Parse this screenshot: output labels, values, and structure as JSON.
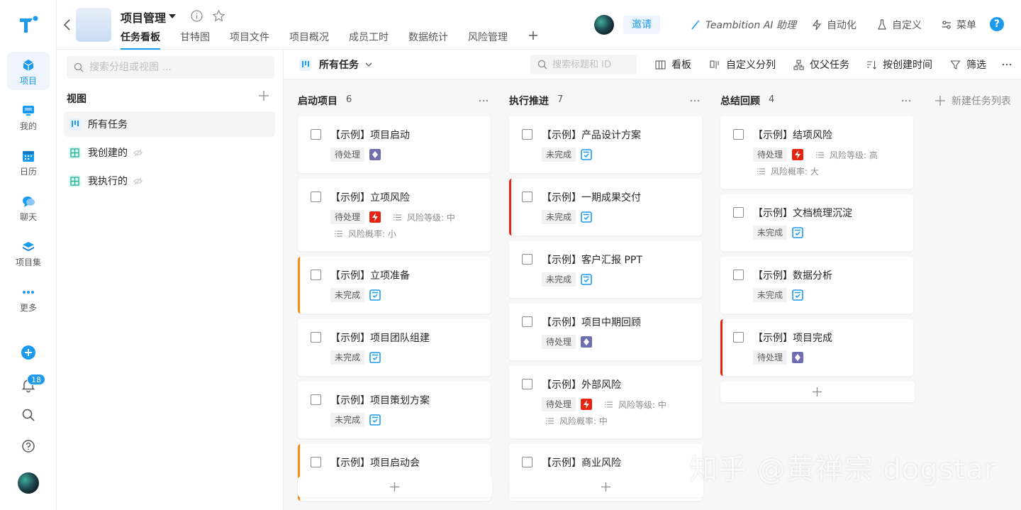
{
  "rail": {
    "items": [
      {
        "label": "项目",
        "icon": "cube-icon"
      },
      {
        "label": "我的",
        "icon": "monitor-icon"
      },
      {
        "label": "日历",
        "icon": "calendar-icon"
      },
      {
        "label": "聊天",
        "icon": "chat-icon"
      },
      {
        "label": "项目集",
        "icon": "layers-icon"
      },
      {
        "label": "更多",
        "icon": "more-icon"
      }
    ],
    "notification_count": "18"
  },
  "header": {
    "project_name": "项目管理",
    "tabs": [
      "任务看板",
      "甘特图",
      "项目文件",
      "项目概况",
      "成员工时",
      "数据统计",
      "风险管理"
    ],
    "invite_label": "邀请",
    "ai_label": "Teambition AI 助理",
    "automation_label": "自动化",
    "customize_label": "自定义",
    "menu_label": "菜单",
    "help_label": "?"
  },
  "views_panel": {
    "search_placeholder": "搜索分组或视图 ...",
    "title": "视图",
    "items": [
      "所有任务",
      "我创建的",
      "我执行的"
    ]
  },
  "toolbar": {
    "current_view": "所有任务",
    "search_placeholder": "搜索标题和 ID",
    "board_label": "看板",
    "custom_columns_label": "自定义分列",
    "parent_only_label": "仅父任务",
    "sort_label": "按创建时间",
    "filter_label": "筛选"
  },
  "board": {
    "new_list_label": "新建任务列表",
    "columns": [
      {
        "title": "启动项目",
        "count": "6",
        "cards": [
          {
            "title": "【示例】项目启动",
            "status": "待处理",
            "type": "milestone"
          },
          {
            "title": "【示例】立项风险",
            "status": "待处理",
            "type": "risk",
            "risk_level": "风险等级: 中",
            "risk_prob": "风险概率: 小"
          },
          {
            "title": "【示例】立项准备",
            "status": "未完成",
            "type": "task",
            "priority": "orange"
          },
          {
            "title": "【示例】项目团队组建",
            "status": "未完成",
            "type": "task"
          },
          {
            "title": "【示例】项目策划方案",
            "status": "未完成",
            "type": "task"
          },
          {
            "title": "【示例】项目启动会",
            "status": "",
            "type": "task",
            "priority": "orange"
          }
        ]
      },
      {
        "title": "执行推进",
        "count": "7",
        "cards": [
          {
            "title": "【示例】产品设计方案",
            "status": "未完成",
            "type": "task"
          },
          {
            "title": "【示例】一期成果交付",
            "status": "未完成",
            "type": "task",
            "priority": "red"
          },
          {
            "title": "【示例】客户汇报 PPT",
            "status": "未完成",
            "type": "task"
          },
          {
            "title": "【示例】项目中期回顾",
            "status": "待处理",
            "type": "milestone"
          },
          {
            "title": "【示例】外部风险",
            "status": "待处理",
            "type": "risk",
            "risk_level": "风险等级: 中",
            "risk_prob": "风险概率: 中"
          },
          {
            "title": "【示例】商业风险",
            "status": "",
            "type": "risk"
          }
        ]
      },
      {
        "title": "总结回顾",
        "count": "4",
        "cards": [
          {
            "title": "【示例】结项风险",
            "status": "待处理",
            "type": "risk",
            "risk_level": "风险等级: 高",
            "risk_prob": "风险概率: 大"
          },
          {
            "title": "【示例】文档梳理沉淀",
            "status": "未完成",
            "type": "task"
          },
          {
            "title": "【示例】数据分析",
            "status": "未完成",
            "type": "task"
          },
          {
            "title": "【示例】项目完成",
            "status": "待处理",
            "type": "milestone",
            "priority": "red"
          }
        ]
      }
    ]
  },
  "watermark": "知乎 @黄禅宗 dogstar",
  "colors": {
    "accent": "#1b9aee",
    "priority_red": "#e62412",
    "priority_orange": "#fa8c15",
    "milestone": "#6e6fb0",
    "risk": "#e62412"
  }
}
